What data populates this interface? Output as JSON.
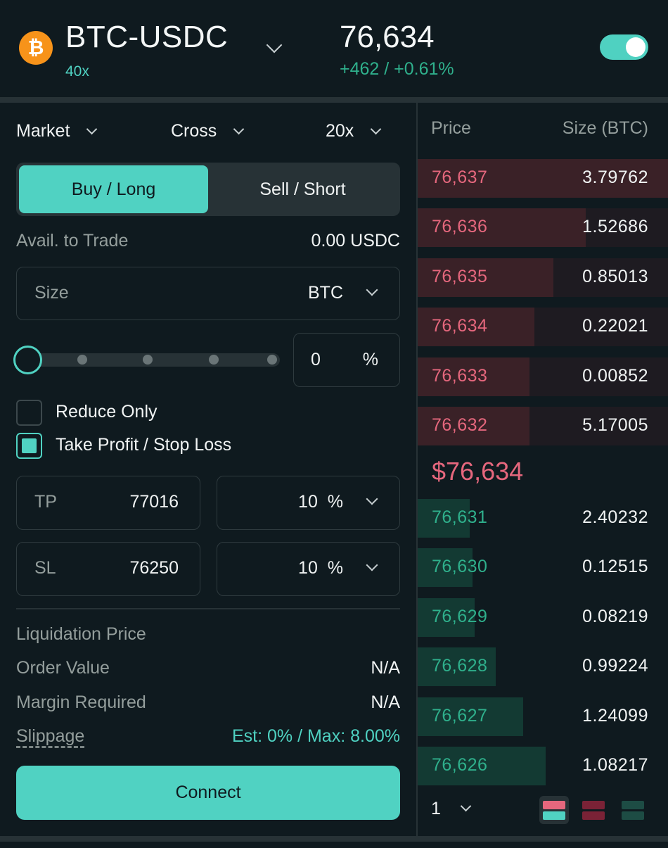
{
  "header": {
    "pair": "BTC-USDC",
    "leverage": "40x",
    "price": "76,634",
    "change": "+462 / +0.61%",
    "coin_icon": "bitcoin-icon",
    "toggle_on": true
  },
  "order_form": {
    "order_type": "Market",
    "margin_mode": "Cross",
    "leverage": "20x",
    "tabs": {
      "buy": "Buy / Long",
      "sell": "Sell / Short",
      "active": "buy"
    },
    "avail_label": "Avail. to Trade",
    "avail_value": "0.00 USDC",
    "size_label": "Size",
    "size_unit": "BTC",
    "slider_percent": 0,
    "percent_value": "0",
    "percent_symbol": "%",
    "reduce_only_label": "Reduce Only",
    "reduce_only_checked": false,
    "tpsl_label": "Take Profit / Stop Loss",
    "tpsl_checked": true,
    "tp_label": "TP",
    "tp_value": "77016",
    "tp_percent": "10",
    "sl_label": "SL",
    "sl_value": "76250",
    "sl_percent": "10",
    "percent_unit": "%",
    "liq_label": "Liquidation Price",
    "order_value_label": "Order Value",
    "order_value": "N/A",
    "margin_label": "Margin Required",
    "margin_value": "N/A",
    "slippage_label": "Slippage",
    "slippage_value": "Est: 0% / Max: 8.00%",
    "connect_label": "Connect"
  },
  "order_book": {
    "price_header": "Price",
    "size_header": "Size (BTC)",
    "asks": [
      {
        "price": "76,637",
        "size": "3.79762"
      },
      {
        "price": "76,636",
        "size": "1.52686"
      },
      {
        "price": "76,635",
        "size": "0.85013"
      },
      {
        "price": "76,634",
        "size": "0.22021"
      },
      {
        "price": "76,633",
        "size": "0.00852"
      },
      {
        "price": "76,632",
        "size": "5.17005"
      }
    ],
    "mid_price": "$76,634",
    "bids": [
      {
        "price": "76,631",
        "size": "2.40232"
      },
      {
        "price": "76,630",
        "size": "0.12515"
      },
      {
        "price": "76,629",
        "size": "0.08219"
      },
      {
        "price": "76,628",
        "size": "0.99224"
      },
      {
        "price": "76,627",
        "size": "1.24099"
      },
      {
        "price": "76,626",
        "size": "1.08217"
      }
    ],
    "grouping": "1",
    "colors": {
      "ask": "#e5677d",
      "bid": "#2fb08c",
      "accent": "#50d2c2"
    }
  }
}
